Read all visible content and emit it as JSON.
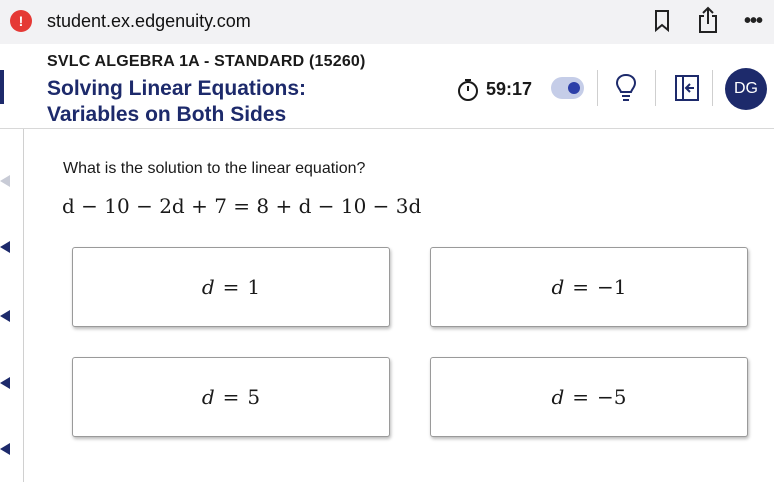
{
  "browser": {
    "url": "student.ex.edgenuity.com",
    "alert_glyph": "!",
    "more_glyph": "•••"
  },
  "header": {
    "course": "SVLC ALGEBRA 1A - STANDARD (15260)",
    "lesson_line1": "Solving Linear Equations:",
    "lesson_line2": "Variables on Both Sides",
    "timer": "59:17",
    "avatar_initials": "DG"
  },
  "colors": {
    "brand_navy": "#1d2a6b",
    "toggle_track": "#c5cde8",
    "toggle_knob": "#2c3fa8",
    "alert_red": "#e53935"
  },
  "icons": [
    "alert-icon",
    "bookmark-icon",
    "share-icon",
    "more-icon",
    "timer-icon",
    "hint-lightbulb-icon",
    "collapse-panel-icon"
  ],
  "question": {
    "prompt": "What is the solution to the linear equation?",
    "equation": "d − 10 − 2d + 7 = 8 + d − 10 − 3d"
  },
  "choices": [
    {
      "var": "d",
      "value": "1"
    },
    {
      "var": "d",
      "value": "−1"
    },
    {
      "var": "d",
      "value": "5"
    },
    {
      "var": "d",
      "value": "−5"
    }
  ]
}
